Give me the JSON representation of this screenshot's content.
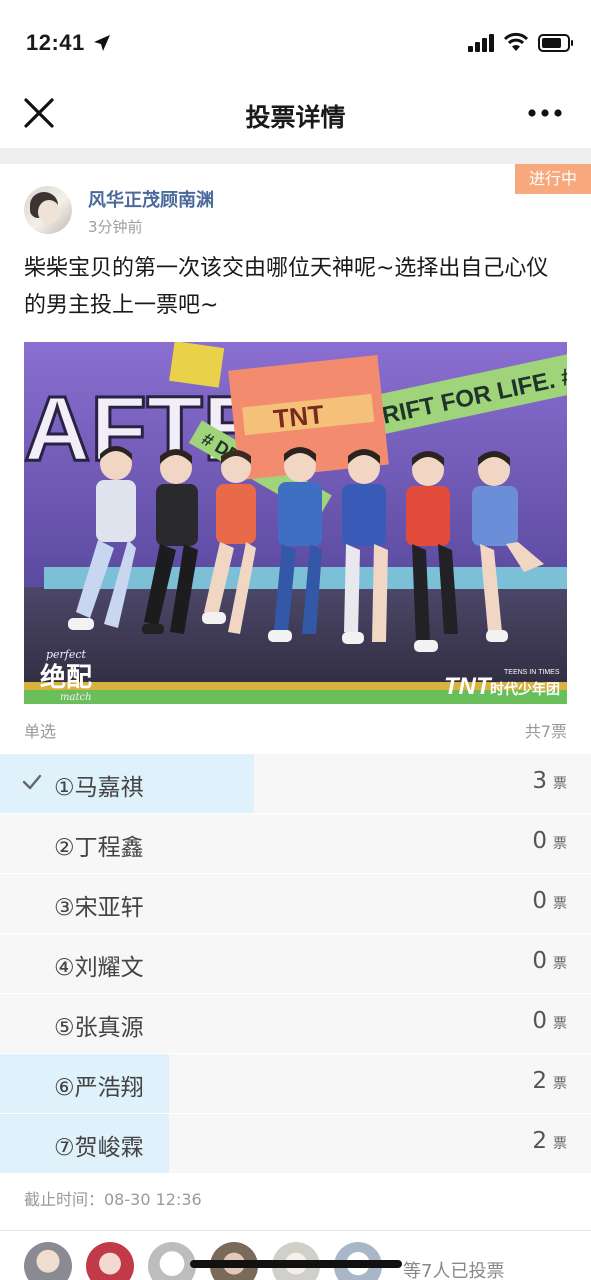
{
  "status_bar": {
    "time": "12:41"
  },
  "nav": {
    "title": "投票详情"
  },
  "post": {
    "status_tag": "进行中",
    "author": "风华正茂顾南渊",
    "time": "3分钟前",
    "text": "柴柴宝贝的第一次该交由哪位天神呢~选择出自己心仪的男主投上一票吧~"
  },
  "image": {
    "banner_text_left": "AFTER",
    "banner_text_right": "# DRIFT FOR LIFE. # DR",
    "banner_word": "# DRIFT",
    "flag_text": "TNT",
    "watermark_left_top": "perfect",
    "watermark_left_main": "绝配",
    "watermark_left_bottom": "match",
    "watermark_right_logo": "TNT",
    "watermark_right_text": "时代少年团",
    "watermark_right_small": "TEENS IN TIMES"
  },
  "poll": {
    "type": "单选",
    "total": "共7票",
    "unit": "票",
    "options": [
      {
        "label": "①马嘉祺",
        "count": "3",
        "share": 0.43,
        "selected": true
      },
      {
        "label": "②丁程鑫",
        "count": "0",
        "share": 0,
        "selected": false
      },
      {
        "label": "③宋亚轩",
        "count": "0",
        "share": 0,
        "selected": false
      },
      {
        "label": "④刘耀文",
        "count": "0",
        "share": 0,
        "selected": false
      },
      {
        "label": "⑤张真源",
        "count": "0",
        "share": 0,
        "selected": false
      },
      {
        "label": "⑥严浩翔",
        "count": "2",
        "share": 0.286,
        "selected": false
      },
      {
        "label": "⑦贺峻霖",
        "count": "2",
        "share": 0.286,
        "selected": false
      }
    ],
    "deadline": "截止时间：08-30 12:36"
  },
  "voters": {
    "summary": "等7人已投票"
  },
  "colors": {
    "accent_tag": "#f7a87c",
    "author_link": "#4a6a9c",
    "bar_fill": "#dff2fb",
    "option_bg": "#f7f7f7"
  }
}
